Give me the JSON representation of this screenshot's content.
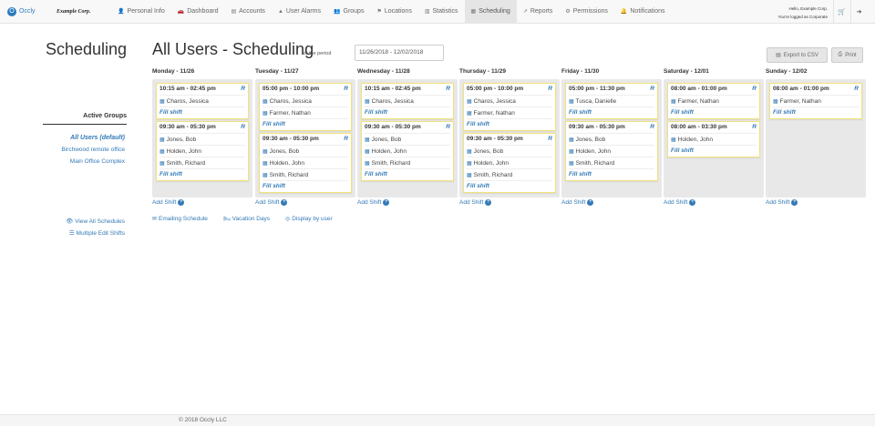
{
  "brand": {
    "logo": "O",
    "name": "Occly",
    "company": "Example Corp."
  },
  "nav": [
    {
      "icon": "👤",
      "icon_name": "user-icon",
      "label": "Personal Info"
    },
    {
      "icon": "🚗",
      "icon_name": "dashboard-icon",
      "label": "Dashboard"
    },
    {
      "icon": "▤",
      "icon_name": "list-icon",
      "label": "Accounts"
    },
    {
      "icon": "▲",
      "icon_name": "alert-icon",
      "label": "User Alarms"
    },
    {
      "icon": "👥",
      "icon_name": "group-icon",
      "label": "Groups"
    },
    {
      "icon": "⚑",
      "icon_name": "map-icon",
      "label": "Locations"
    },
    {
      "icon": "▥",
      "icon_name": "bar-chart-icon",
      "label": "Statistics"
    },
    {
      "icon": "▦",
      "icon_name": "calendar-icon",
      "label": "Scheduling",
      "active": true
    },
    {
      "icon": "↗",
      "icon_name": "line-chart-icon",
      "label": "Reports"
    },
    {
      "icon": "⚙",
      "icon_name": "gear-icon",
      "label": "Permissions"
    },
    {
      "icon": "🔔",
      "icon_name": "bell-icon",
      "label": "Notifications"
    }
  ],
  "user": {
    "hello": "Hello, Example Corp.",
    "logged_as": "You're logged as Corporate"
  },
  "sidebar": {
    "title": "Scheduling",
    "groups_heading": "Active Groups",
    "groups": [
      "All Users (default)",
      "Birchwood remote office",
      "Main Office Complex"
    ],
    "view_all": "View All Schedules",
    "multiple_edit": "Multiple Edit Shifts"
  },
  "header": {
    "title": "All Users - Scheduling",
    "period_label": "for the period",
    "period_value": "11/26/2018 - 12/02/2018",
    "export_label": "Export to CSV",
    "print_label": "Print"
  },
  "days": [
    {
      "label": "Monday - 11/26",
      "shifts": [
        {
          "time": "10:15 am - 02:45 pm",
          "flag": "R",
          "employees": [
            "Charos, Jessica"
          ],
          "fill": "Fill shift"
        },
        {
          "time": "09:30 am - 05:30 pm",
          "flag": "R",
          "employees": [
            "Jones, Bob",
            "Holden, John",
            "Smith, Richard"
          ],
          "fill": "Fill shift"
        }
      ],
      "add": "Add Shift"
    },
    {
      "label": "Tuesday - 11/27",
      "shifts": [
        {
          "time": "05:00 pm - 10:00 pm",
          "flag": "R",
          "employees": [
            "Charos, Jessica",
            "Farmer, Nathan"
          ],
          "fill": "Fill shift"
        },
        {
          "time": "09:30 am - 05:30 pm",
          "flag": "R",
          "employees": [
            "Jones, Bob",
            "Holden, John",
            "Smith, Richard"
          ],
          "fill": "Fill shift"
        }
      ],
      "add": "Add Shift"
    },
    {
      "label": "Wednesday - 11/28",
      "shifts": [
        {
          "time": "10:15 am - 02:45 pm",
          "flag": "R",
          "employees": [
            "Charos, Jessica"
          ],
          "fill": "Fill shift"
        },
        {
          "time": "09:30 am - 05:30 pm",
          "flag": "R",
          "employees": [
            "Jones, Bob",
            "Holden, John",
            "Smith, Richard"
          ],
          "fill": "Fill shift"
        }
      ],
      "add": "Add Shift"
    },
    {
      "label": "Thursday - 11/29",
      "shifts": [
        {
          "time": "05:00 pm - 10:00 pm",
          "flag": "R",
          "employees": [
            "Charos, Jessica",
            "Farmer, Nathan"
          ],
          "fill": "Fill shift"
        },
        {
          "time": "09:30 am - 05:30 pm",
          "flag": "R",
          "employees": [
            "Jones, Bob",
            "Holden, John",
            "Smith, Richard"
          ],
          "fill": "Fill shift"
        }
      ],
      "add": "Add Shift"
    },
    {
      "label": "Friday - 11/30",
      "shifts": [
        {
          "time": "05:00 pm - 11:30 pm",
          "flag": "R",
          "employees": [
            "Tusca, Danielle"
          ],
          "fill": "Fill shift"
        },
        {
          "time": "09:30 am - 05:30 pm",
          "flag": "R",
          "employees": [
            "Jones, Bob",
            "Holden, John",
            "Smith, Richard"
          ],
          "fill": "Fill shift"
        }
      ],
      "add": "Add Shift"
    },
    {
      "label": "Saturday - 12/01",
      "shifts": [
        {
          "time": "08:00 am - 01:00 pm",
          "flag": "R",
          "employees": [
            "Farmer, Nathan"
          ],
          "fill": "Fill shift"
        },
        {
          "time": "08:00 am - 03:30 pm",
          "flag": "R",
          "employees": [
            "Holden, John"
          ],
          "fill": "Fill shift"
        }
      ],
      "add": "Add Shift"
    },
    {
      "label": "Sunday - 12/02",
      "shifts": [
        {
          "time": "08:00 am - 01:00 pm",
          "flag": "R",
          "employees": [
            "Farmer, Nathan"
          ],
          "fill": "Fill shift"
        }
      ],
      "add": "Add Shift"
    }
  ],
  "links": {
    "emailing": "Emailing Schedule",
    "vacation": "Vacation Days",
    "display_by_user": "Display by user"
  },
  "footer": "© 2018 Occly LLC"
}
